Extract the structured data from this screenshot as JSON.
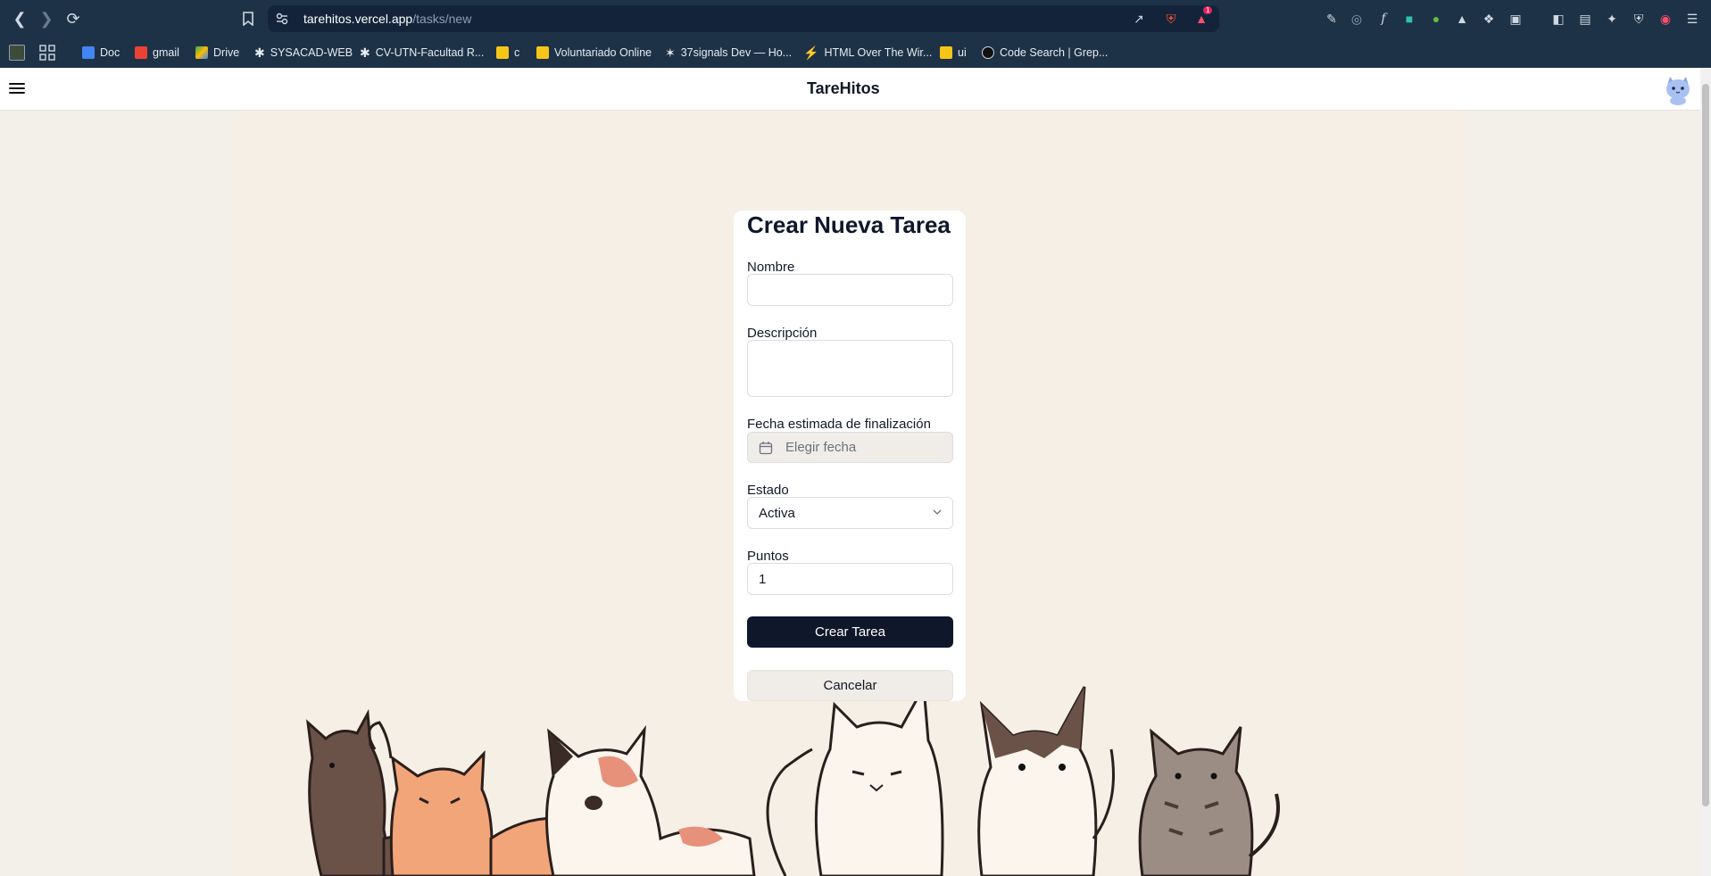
{
  "browser": {
    "url_host": "tarehitos.vercel.app",
    "url_path": "/tasks/new",
    "notification_count": "1",
    "bookmarks": [
      {
        "label": "Doc",
        "icon": "docs-icon",
        "color": "#4285f4"
      },
      {
        "label": "gmail",
        "icon": "gmail-icon",
        "color": "#ea4335"
      },
      {
        "label": "Drive",
        "icon": "drive-icon",
        "color": "#34a853"
      },
      {
        "label": "SYSACAD-WEB",
        "icon": "sysacad-icon",
        "color": "#222222"
      },
      {
        "label": "CV-UTN-Facultad R...",
        "icon": "cv-icon",
        "color": "#222222"
      },
      {
        "label": "c",
        "icon": "folder-icon",
        "color": "#f5c518"
      },
      {
        "label": "Voluntariado Online",
        "icon": "folder-icon",
        "color": "#f5c518"
      },
      {
        "label": "37signals Dev — Ho...",
        "icon": "37signals-icon",
        "color": "#222222"
      },
      {
        "label": "HTML Over The Wir...",
        "icon": "hotwire-icon",
        "color": "#ffffff"
      },
      {
        "label": "ui",
        "icon": "folder-icon",
        "color": "#f5c518"
      },
      {
        "label": "Code Search | Grep...",
        "icon": "grep-icon",
        "color": "#111111"
      }
    ]
  },
  "app": {
    "title": "TareHitos"
  },
  "form": {
    "title": "Crear Nueva Tarea",
    "nombre_label": "Nombre",
    "nombre_value": "",
    "descripcion_label": "Descripción",
    "descripcion_value": "",
    "fecha_label": "Fecha estimada de finalización",
    "fecha_placeholder": "Elegir fecha",
    "estado_label": "Estado",
    "estado_value": "Activa",
    "puntos_label": "Puntos",
    "puntos_value": "1",
    "submit_label": "Crear Tarea",
    "cancel_label": "Cancelar"
  },
  "colors": {
    "chrome_bg": "#1e3247",
    "primary_button": "#0f172a",
    "page_bg": "#f6efe6"
  }
}
